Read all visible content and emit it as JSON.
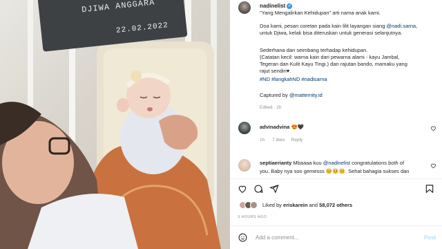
{
  "photo": {
    "plaque_name": "DJIWA ANGGARA",
    "plaque_date": "22.02.2022"
  },
  "post": {
    "author": "nadinelist",
    "caption_lines": [
      "\"Yang Mengalirkan Kehidupan\" arti nama anak kami.",
      "Doa kami, pesan coretan pada kain lilit layangan siang ",
      "untuk Djiwa, kelak bisa diteruskan untuk generasi selanjutnya.",
      "Sederhana dan seimbang terhadap kehidupan.",
      "(Catatan kecil: warna kain dari pewarna alami - kayu Jambal,",
      "Tegeran dan Kulit Kayu Tingi.) dan rajutan bando, mamaku yang",
      "rajut sendiri♥.",
      "#ND #langkahND #nadisarna",
      "Captured by "
    ],
    "mention_1": "@nadi.sarna,",
    "mention_2": "@matternity.id",
    "edited_meta": "Edited · 2h"
  },
  "comments": [
    {
      "username": "advinadvina",
      "text": "😍🖤",
      "meta_time": "1h",
      "meta_likes": "7 likes",
      "meta_reply": "Reply"
    },
    {
      "username": "septiaerianty",
      "text_line1": "Mbaaaa kuu ",
      "mention": "@nadinelist",
      "text_line1_rest": " congratulations both of",
      "text_line2": "you. Baby nya soo gemesss 🥺🥺🥺. Sehat bahagia sukses dan"
    }
  ],
  "likes": {
    "prefix": "Liked by ",
    "user": "eriskarein",
    "mid": " and ",
    "count": "58,072 others"
  },
  "timestamp": "3 HOURS AGO",
  "composer": {
    "placeholder": "Add a comment...",
    "post_label": "Post"
  },
  "colors": {
    "link": "#00376b",
    "verified": "#3797f0",
    "muted": "#8e8e8e",
    "post_disabled": "#b2dffc"
  },
  "icons": [
    "heart-icon",
    "comment-icon",
    "share-icon",
    "bookmark-icon",
    "emoji-icon",
    "verified-icon"
  ]
}
